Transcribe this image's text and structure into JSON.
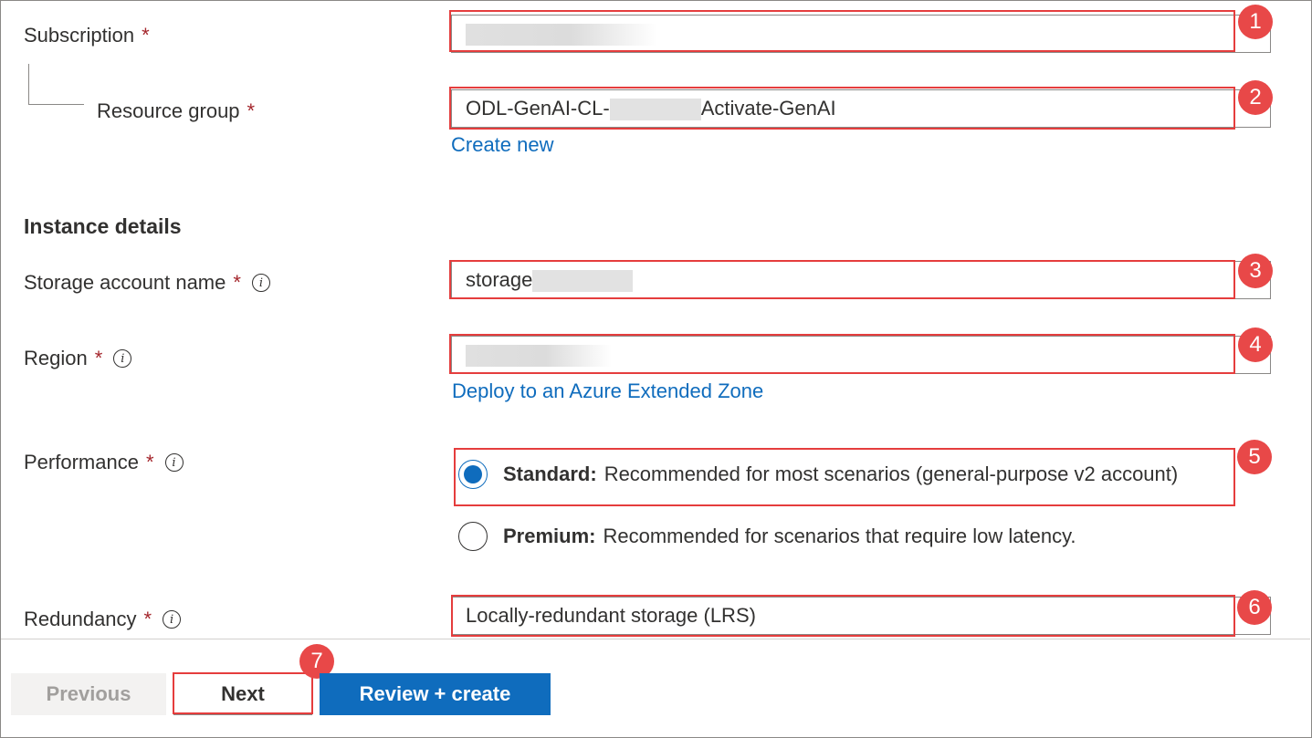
{
  "project": {
    "subscription_label": "Subscription",
    "subscription_value": "",
    "resource_group_label": "Resource group",
    "resource_group_prefix": "ODL-GenAI-CL-",
    "resource_group_suffix": "Activate-GenAI",
    "create_new_link": "Create new"
  },
  "instance": {
    "heading": "Instance details",
    "storage_name_label": "Storage account name",
    "storage_name_value": "storage",
    "region_label": "Region",
    "region_value": "",
    "extended_zone_link": "Deploy to an Azure Extended Zone",
    "performance_label": "Performance",
    "performance_options": [
      {
        "title": "Standard:",
        "desc": "Recommended for most scenarios (general-purpose v2 account)",
        "selected": true
      },
      {
        "title": "Premium:",
        "desc": "Recommended for scenarios that require low latency.",
        "selected": false
      }
    ],
    "redundancy_label": "Redundancy",
    "redundancy_value": "Locally-redundant storage (LRS)"
  },
  "required_marker": "*",
  "info_glyph": "i",
  "annotations": [
    "1",
    "2",
    "3",
    "4",
    "5",
    "6",
    "7"
  ],
  "footer": {
    "previous_label": "Previous",
    "next_label": "Next",
    "review_label": "Review + create"
  },
  "colors": {
    "accent": "#0f6cbd",
    "required": "#a4262c",
    "annotation": "#e84848"
  }
}
